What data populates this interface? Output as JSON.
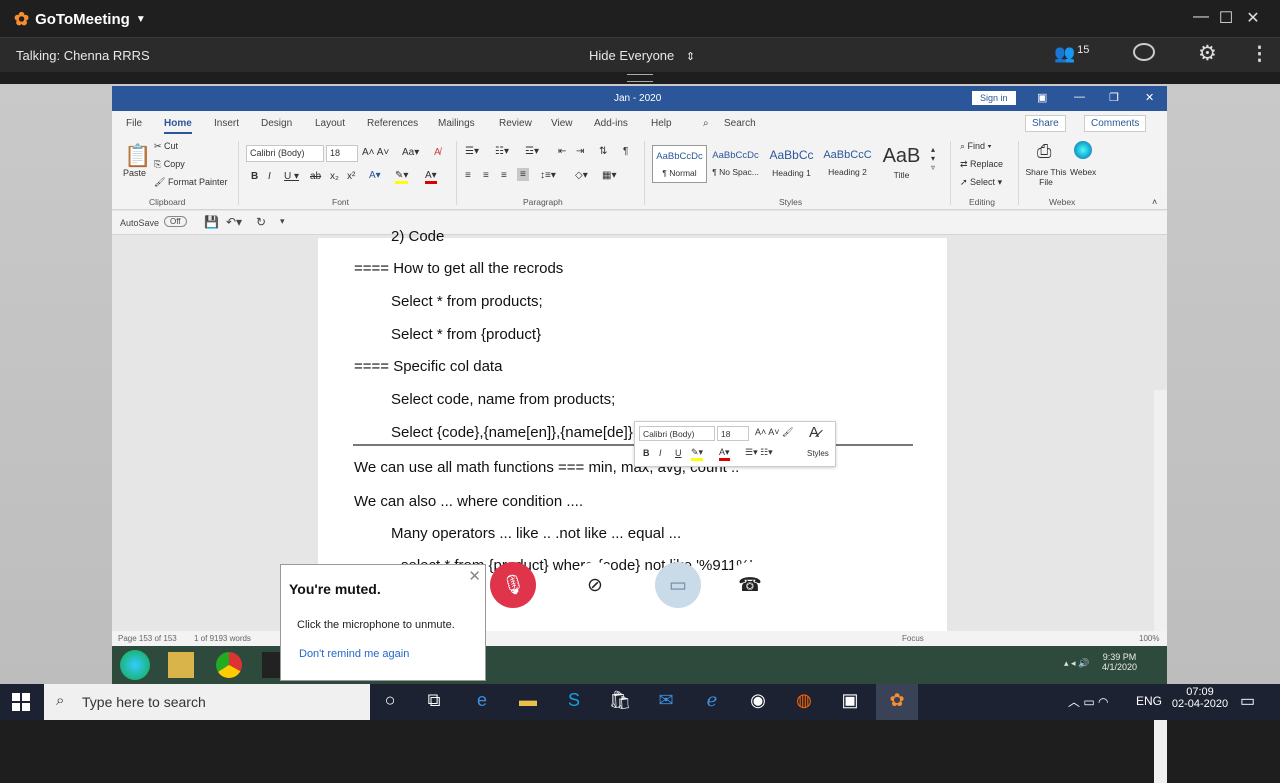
{
  "goto": {
    "app_name": "GoToMeeting",
    "talking": "Talking: Chenna RRRS",
    "view_mode": "Hide Everyone",
    "participant_count": "15"
  },
  "word": {
    "title": "Jan - 2020",
    "sign_in": "Sign in",
    "tabs": [
      "File",
      "Home",
      "Insert",
      "Design",
      "Layout",
      "References",
      "Mailings",
      "Review",
      "View",
      "Add-ins",
      "Help"
    ],
    "search": "Search",
    "share": "Share",
    "comments": "Comments",
    "clipboard": {
      "paste": "Paste",
      "cut": "Cut",
      "copy": "Copy",
      "format_painter": "Format Painter",
      "label": "Clipboard"
    },
    "font": {
      "name": "Calibri (Body)",
      "size": "18",
      "label": "Font"
    },
    "paragraph_label": "Paragraph",
    "styles": [
      {
        "preview": "AaBbCcDc",
        "name": "¶ Normal"
      },
      {
        "preview": "AaBbCcDc",
        "name": "¶ No Spac..."
      },
      {
        "preview": "AaBbCc",
        "name": "Heading 1"
      },
      {
        "preview": "AaBbCcC",
        "name": "Heading 2"
      },
      {
        "preview": "AaB",
        "name": "Title"
      }
    ],
    "styles_label": "Styles",
    "editing": {
      "find": "Find",
      "replace": "Replace",
      "select": "Select",
      "label": "Editing"
    },
    "webex": {
      "share": "Share This File",
      "webex": "Webex",
      "label": "Webex"
    },
    "autosave": "AutoSave",
    "autosave_state": "Off",
    "doc_lines": [
      "2) Code",
      "==== How to get all the recrods",
      "Select * from products;",
      "Select * from {product}",
      "==== Specific col data",
      "Select code, name from products;",
      "Select {code},{name[en]},{name[de]} from {product}",
      "We can use all math functions === min, max, avg, count ..",
      "We can also ... where condition ....",
      "Many operators ... like .. .not like ... equal ...",
      "select * from {product} where {code} not like '%911%'"
    ],
    "mini_toolbar": {
      "font": "Calibri (Body)",
      "size": "18",
      "styles": "Styles"
    },
    "status": {
      "page": "Page 153 of 153",
      "words": "1 of 9193 words",
      "focus": "Focus",
      "zoom": "100%"
    }
  },
  "call_controls": [
    {
      "label": "Mic"
    },
    {
      "label": "Camera"
    },
    {
      "label": "Screen"
    },
    {
      "label": "Leave"
    }
  ],
  "muted_popup": {
    "title": "You're muted.",
    "body": "Click the microphone to unmute.",
    "link": "Don't remind me again"
  },
  "remote_clock": {
    "time": "9:39 PM",
    "date": "4/1/2020"
  },
  "taskbar": {
    "search_placeholder": "Type here to search",
    "language": "ENG",
    "time": "07:09",
    "date": "02-04-2020"
  },
  "colors": {
    "goto_orange": "#f68d2e",
    "word_blue": "#2b579a",
    "mic_red": "#e0344a"
  }
}
